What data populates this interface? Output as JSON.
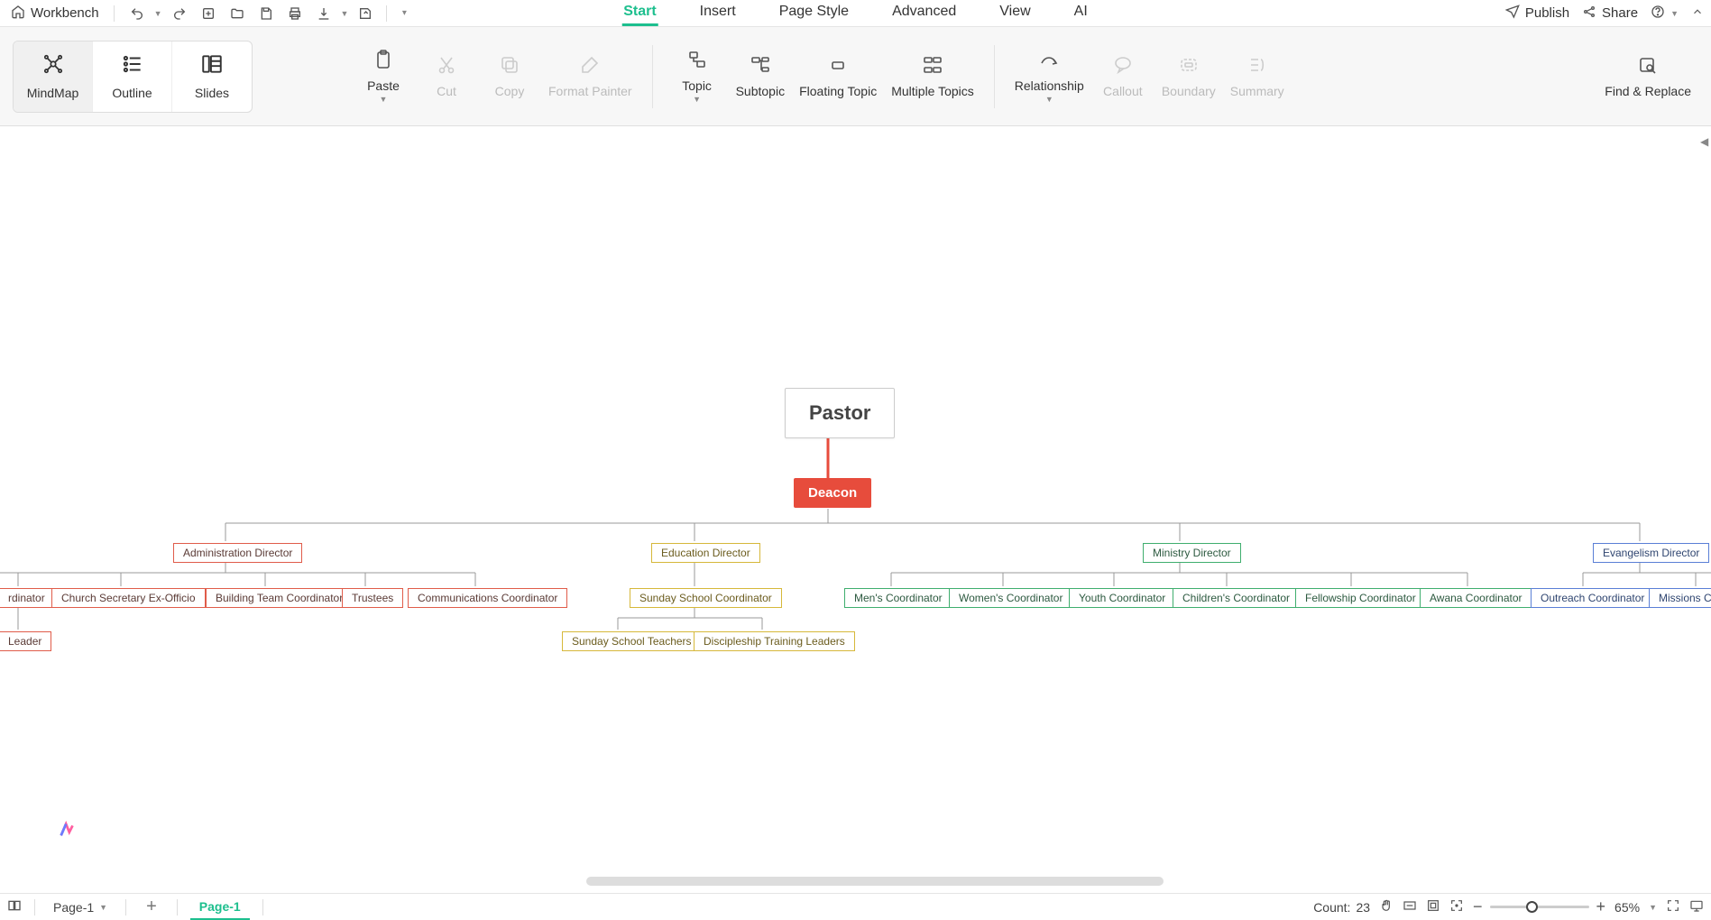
{
  "topbar": {
    "workbench": "Workbench"
  },
  "menu": {
    "tabs": [
      "Start",
      "Insert",
      "Page Style",
      "Advanced",
      "View",
      "AI"
    ],
    "active": 0
  },
  "topright": {
    "publish": "Publish",
    "share": "Share"
  },
  "view_switch": {
    "mindmap": "MindMap",
    "outline": "Outline",
    "slides": "Slides"
  },
  "ribbon": {
    "paste": "Paste",
    "cut": "Cut",
    "copy": "Copy",
    "format_painter": "Format Painter",
    "topic": "Topic",
    "subtopic": "Subtopic",
    "floating_topic": "Floating Topic",
    "multiple_topics": "Multiple Topics",
    "relationship": "Relationship",
    "callout": "Callout",
    "boundary": "Boundary",
    "summary": "Summary",
    "find_replace": "Find & Replace"
  },
  "org": {
    "pastor": "Pastor",
    "deacon": "Deacon",
    "admin_dir": "Administration Director",
    "edu_dir": "Education Director",
    "min_dir": "Ministry Director",
    "evg_dir": "Evangelism Director",
    "admin": {
      "a0": "rdinator",
      "a1": "Church Secretary Ex-Officio",
      "a2": "Building Team Coordinator",
      "a3": "Trustees",
      "a4": "Communications Coordinator",
      "leader": "Leader"
    },
    "edu": {
      "e0": "Sunday School Coordinator",
      "e1": "Sunday School Teachers",
      "e2": "Discipleship Training Leaders"
    },
    "min": {
      "m0": "Men's Coordinator",
      "m1": "Women's Coordinator",
      "m2": "Youth Coordinator",
      "m3": "Children's Coordinator",
      "m4": "Fellowship Coordinator",
      "m5": "Awana Coordinator"
    },
    "evg": {
      "v0": "Outreach Coordinator",
      "v1": "Missions Coo"
    }
  },
  "status": {
    "page_select": "Page-1",
    "page_tab": "Page-1",
    "count_label": "Count:",
    "count_value": "23",
    "zoom_pct": "65%"
  }
}
